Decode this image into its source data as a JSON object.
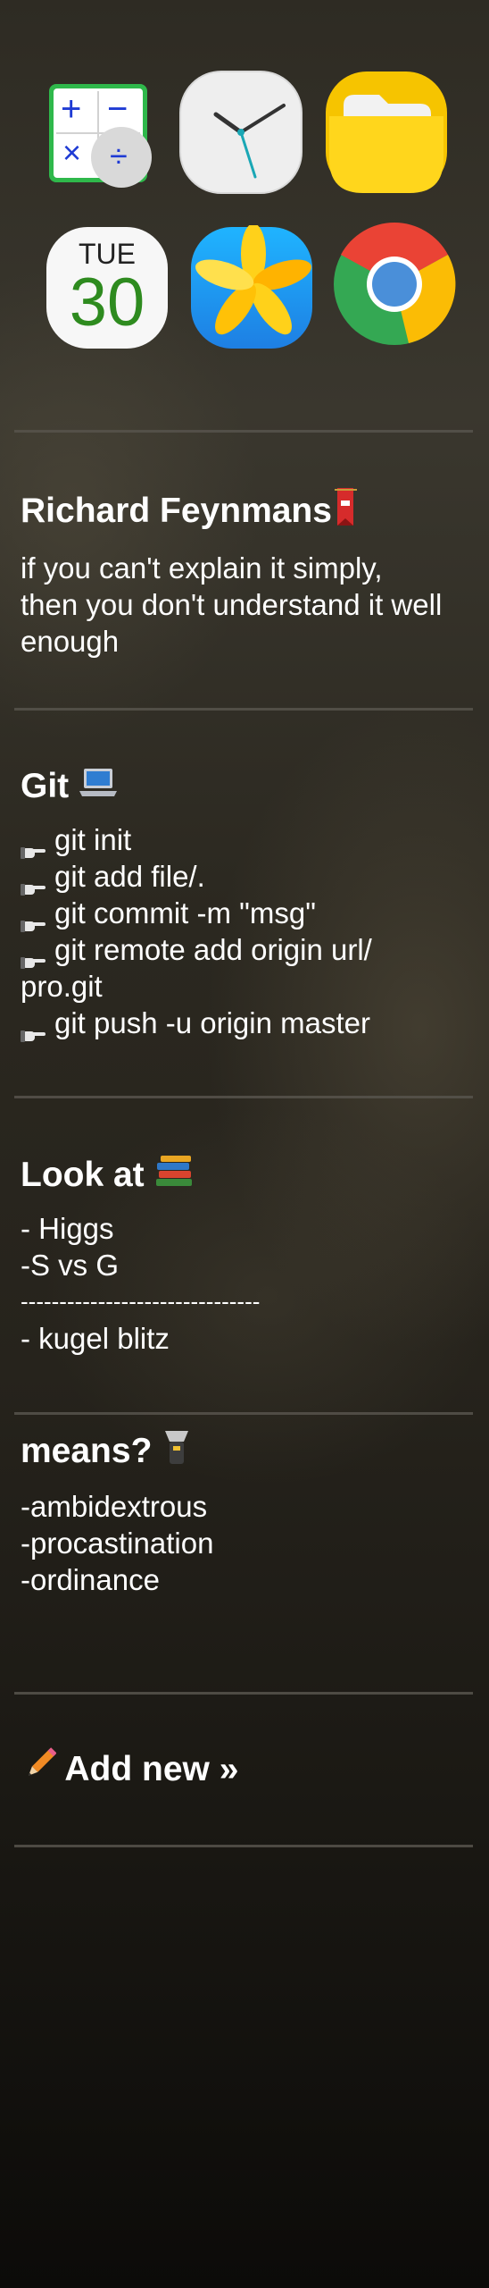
{
  "apps": [
    {
      "name": "calculator-app-icon",
      "symbols": [
        "+",
        "−",
        "×",
        "÷"
      ]
    },
    {
      "name": "clock-app-icon"
    },
    {
      "name": "files-app-icon"
    },
    {
      "name": "calendar-app-icon",
      "weekday": "TUE",
      "day": "30"
    },
    {
      "name": "gallery-app-icon"
    },
    {
      "name": "chrome-app-icon"
    }
  ],
  "notes": [
    {
      "title": "Richard Feynmans",
      "title_emoji": "bookmark-icon",
      "lines": [
        "if you can't explain it simply,",
        "then you don't understand it well",
        "enough"
      ]
    },
    {
      "title": "Git",
      "title_emoji": "laptop-icon",
      "lines": [
        "git init",
        "git add file/.",
        "git commit -m \"msg\"",
        "git remote add origin url/",
        "pro.git",
        "git push -u origin master"
      ],
      "bullet_icon": "pointing-hand-icon"
    },
    {
      "title": "Look at",
      "title_emoji": "books-icon",
      "lines": [
        "- Higgs",
        "-S vs G",
        "-------------------------------",
        "- kugel blitz"
      ]
    },
    {
      "title": "means?",
      "title_emoji": "flashlight-icon",
      "lines": [
        "-ambidextrous",
        "-procastination",
        "-ordinance"
      ]
    }
  ],
  "add_new": {
    "label": "Add new »",
    "icon": "pencil-icon"
  }
}
